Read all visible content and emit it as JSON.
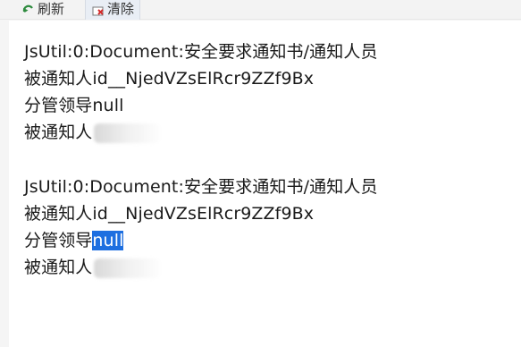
{
  "toolbar": {
    "refresh_label": "刷新",
    "clear_label": "清除",
    "refresh_icon": "refresh-icon",
    "clear_icon": "clear-icon",
    "colors": {
      "refresh_icon": "#2e8b3e",
      "clear_icon": "#d42a2a"
    }
  },
  "log": {
    "entries": [
      {
        "header": "JsUtil:0:Document:安全要求通知书/通知人员",
        "id_line": "被通知人id__NjedVZsElRcr9ZZf9Bx",
        "leader_label": "分管领导",
        "leader_value": "null",
        "notified_label": "被通知人"
      },
      {
        "header": "JsUtil:0:Document:安全要求通知书/通知人员",
        "id_line": "被通知人id__NjedVZsElRcr9ZZf9Bx",
        "leader_label": "分管领导",
        "leader_value": "null",
        "notified_label": "被通知人"
      }
    ]
  },
  "selection": {
    "color": "#1e6fe0"
  }
}
